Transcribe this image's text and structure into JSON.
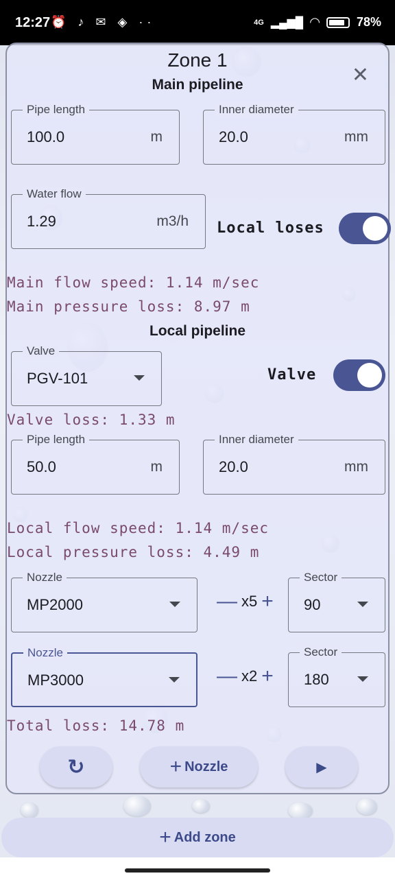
{
  "status": {
    "time": "12:27",
    "icons": "⏰ ♪ ✉ ◈ ··",
    "network": "4G",
    "battery": "78%"
  },
  "dialog": {
    "title": "Zone 1",
    "close_icon": "✕",
    "main_section": "Main pipeline",
    "main_pipe_length": {
      "label": "Pipe length",
      "value": "100.0",
      "unit": "m"
    },
    "main_inner_diameter": {
      "label": "Inner diameter",
      "value": "20.0",
      "unit": "mm"
    },
    "water_flow": {
      "label": "Water flow",
      "value": "1.29",
      "unit": "m3/h"
    },
    "local_loses_label": "Local loses",
    "local_loses_on": true,
    "main_flow_speed": "Main flow speed: 1.14 m/sec",
    "main_pressure_loss": "Main pressure loss: 8.97 m",
    "local_section": "Local pipeline",
    "valve_select": {
      "label": "Valve",
      "value": "PGV-101"
    },
    "valve_label": "Valve",
    "valve_on": true,
    "valve_loss": "Valve loss: 1.33 m",
    "local_pipe_length": {
      "label": "Pipe length",
      "value": "50.0",
      "unit": "m"
    },
    "local_inner_diameter": {
      "label": "Inner diameter",
      "value": "20.0",
      "unit": "mm"
    },
    "local_flow_speed": "Local flow speed: 1.14 m/sec",
    "local_pressure_loss": "Local pressure loss: 4.49 m",
    "nozzles": [
      {
        "label": "Nozzle",
        "value": "MP2000",
        "count": "x5",
        "sector_label": "Sector",
        "sector": "90"
      },
      {
        "label": "Nozzle",
        "value": "MP3000",
        "count": "x2",
        "sector_label": "Sector",
        "sector": "180"
      }
    ],
    "minus": "—",
    "plus": "+",
    "total_loss": "Total loss: 14.78 m",
    "refresh_icon": "↻",
    "add_nozzle_label": "Nozzle",
    "play_icon": "▶"
  },
  "add_zone_label": "Add zone",
  "colors": {
    "accent": "#4a5693",
    "mono_text": "#7a4a6e",
    "pill_bg": "#d9dbf3"
  }
}
